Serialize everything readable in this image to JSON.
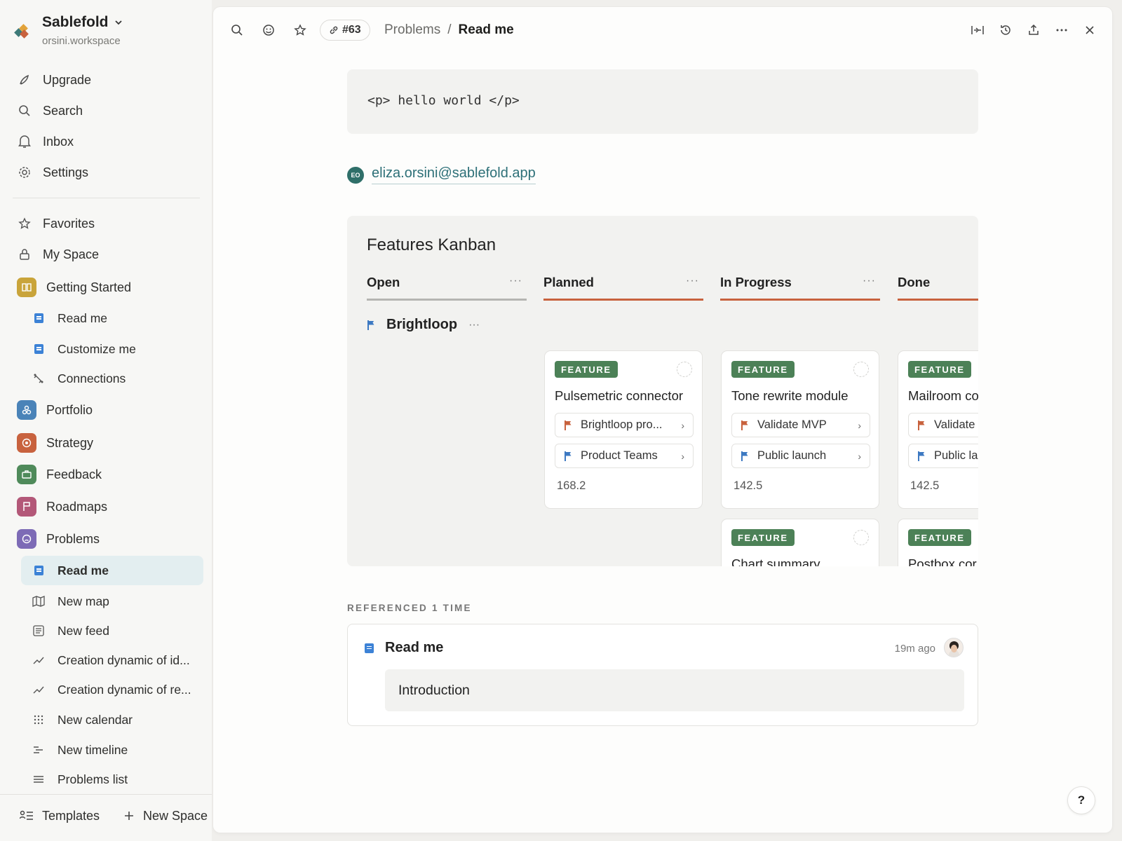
{
  "workspace": {
    "name": "Sablefold",
    "subdomain": "orsini.workspace"
  },
  "sidebar": {
    "top_items": [
      {
        "label": "Upgrade",
        "icon": "rocket-icon"
      },
      {
        "label": "Search",
        "icon": "search-icon"
      },
      {
        "label": "Inbox",
        "icon": "bell-icon"
      },
      {
        "label": "Settings",
        "icon": "gear-icon"
      }
    ],
    "favorites": "Favorites",
    "my_space": "My Space",
    "spaces": [
      {
        "label": "Getting Started",
        "color": "#c9a43a",
        "children": [
          "Read me",
          "Customize me",
          "Connections"
        ]
      },
      {
        "label": "Portfolio",
        "color": "#4a83b8"
      },
      {
        "label": "Strategy",
        "color": "#c8623e"
      },
      {
        "label": "Feedback",
        "color": "#4f8a5a"
      },
      {
        "label": "Roadmaps",
        "color": "#b35878"
      },
      {
        "label": "Problems",
        "color": "#7d6bb6",
        "children": [
          "Read me",
          "New map",
          "New feed",
          "Creation dynamic of id...",
          "Creation dynamic of re...",
          "New calendar",
          "New timeline",
          "Problems list"
        ]
      }
    ],
    "footer": {
      "templates": "Templates",
      "new_space": "New Space"
    }
  },
  "topbar": {
    "link_id": "#63",
    "breadcrumb_parent": "Problems",
    "breadcrumb_sep": "/",
    "breadcrumb_current": "Read me"
  },
  "content": {
    "code": "<p> hello world </p>",
    "mention": {
      "initials": "EO",
      "email": "eliza.orsini@sablefold.app"
    },
    "kanban": {
      "title": "Features Kanban",
      "columns": [
        {
          "label": "Open",
          "color": "#b5b5b2"
        },
        {
          "label": "Planned",
          "color": "#c8623e"
        },
        {
          "label": "In Progress",
          "color": "#c8623e"
        },
        {
          "label": "Done",
          "color": "#c8623e"
        }
      ],
      "group": "Brightloop",
      "cards": [
        {
          "badge": "FEATURE",
          "title": "Pulsemetric connector",
          "rel1": "Brightloop pro...",
          "rel2": "Product Teams",
          "value": "168.2"
        },
        {
          "badge": "FEATURE",
          "title": "Tone rewrite module",
          "rel1": "Validate MVP",
          "rel2": "Public launch",
          "value": "142.5"
        },
        {
          "badge": "FEATURE",
          "title": "Mailroom co",
          "rel1": "Validate",
          "rel2": "Public la",
          "value": "142.5"
        },
        {
          "badge": "FEATURE",
          "title": "Chart summary"
        },
        {
          "badge": "FEATURE",
          "title": "Postbox cor"
        }
      ]
    },
    "references": {
      "label": "REFERENCED 1 TIME",
      "title": "Read me",
      "time": "19m ago",
      "snippet": "Introduction"
    }
  },
  "help": "?"
}
